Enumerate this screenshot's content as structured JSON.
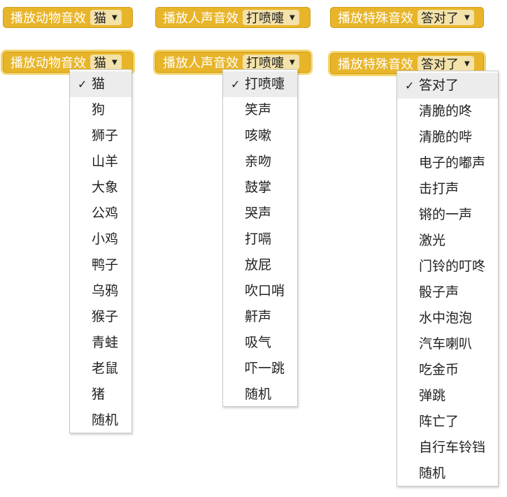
{
  "blocks": {
    "top": [
      {
        "label": "播放动物音效",
        "value": "猫"
      },
      {
        "label": "播放人声音效",
        "value": "打喷嚏"
      },
      {
        "label": "播放特殊音效",
        "value": "答对了"
      }
    ],
    "bottom": [
      {
        "label": "播放动物音效",
        "value": "猫"
      },
      {
        "label": "播放人声音效",
        "value": "打喷嚏"
      },
      {
        "label": "播放特殊音效",
        "value": "答对了"
      }
    ]
  },
  "menus": {
    "animal": {
      "selected": "猫",
      "items": [
        "猫",
        "狗",
        "狮子",
        "山羊",
        "大象",
        "公鸡",
        "小鸡",
        "鸭子",
        "乌鸦",
        "猴子",
        "青蛙",
        "老鼠",
        "猪",
        "随机"
      ]
    },
    "human": {
      "selected": "打喷嚏",
      "items": [
        "打喷嚏",
        "笑声",
        "咳嗽",
        "亲吻",
        "鼓掌",
        "哭声",
        "打嗝",
        "放屁",
        "吹口哨",
        "鼾声",
        "吸气",
        "吓一跳",
        "随机"
      ]
    },
    "special": {
      "selected": "答对了",
      "items": [
        "答对了",
        "清脆的咚",
        "清脆的哔",
        "电子的嘟声",
        "击打声",
        "锵的一声",
        "激光",
        "门铃的叮咚",
        "骰子声",
        "水中泡泡",
        "汽车喇叭",
        "吃金币",
        "弹跳",
        "阵亡了",
        "自行车铃铛",
        "随机"
      ]
    }
  },
  "icons": {
    "dropdown_arrow": "▼",
    "check": "✓"
  }
}
